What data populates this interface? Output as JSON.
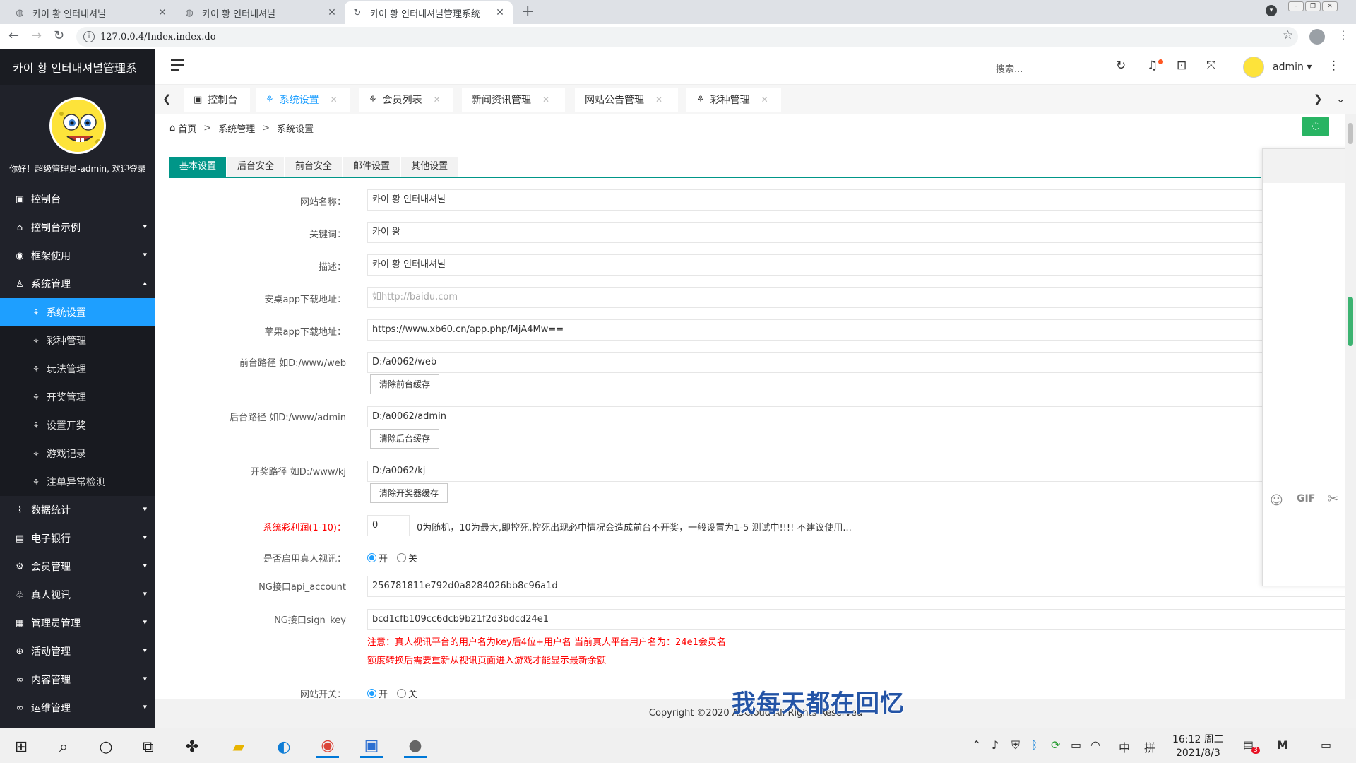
{
  "browser": {
    "tabs": [
      {
        "title": "카이 황 인터내셔널",
        "active": false
      },
      {
        "title": "카이 황 인터내셔널",
        "active": false
      },
      {
        "title": "카이 황 인터내셔널管理系统",
        "active": true
      }
    ],
    "new_tab": "+",
    "url": "127.0.0.4/Index.index.do"
  },
  "sidebar": {
    "logo": "카이 황 인터내셔널管理系",
    "welcome": "你好！超级管理员-admin, 欢迎登录",
    "menu": [
      {
        "label": "控制台",
        "icon": "dashboard-icon",
        "glyph": "▣",
        "has_arrow": false
      },
      {
        "label": "控制台示例",
        "icon": "home-icon",
        "glyph": "⌂",
        "has_arrow": true
      },
      {
        "label": "框架使用",
        "icon": "layers-icon",
        "glyph": "◉",
        "has_arrow": true
      },
      {
        "label": "系统管理",
        "icon": "user-icon",
        "glyph": "♙",
        "has_arrow": true,
        "expanded": true
      }
    ],
    "submenu": [
      {
        "label": "系统设置",
        "active": true
      },
      {
        "label": "彩种管理",
        "active": false
      },
      {
        "label": "玩法管理",
        "active": false
      },
      {
        "label": "开奖管理",
        "active": false
      },
      {
        "label": "设置开奖",
        "active": false
      },
      {
        "label": "游戏记录",
        "active": false
      },
      {
        "label": "注单异常检测",
        "active": false
      }
    ],
    "menu_after": [
      {
        "label": "数据统计",
        "icon": "chart-icon",
        "glyph": "⌇"
      },
      {
        "label": "电子银行",
        "icon": "bank-icon",
        "glyph": "▤"
      },
      {
        "label": "会员管理",
        "icon": "settings-icon",
        "glyph": "⚙"
      },
      {
        "label": "真人视讯",
        "icon": "video-icon",
        "glyph": "♧"
      },
      {
        "label": "管理员管理",
        "icon": "grid-icon",
        "glyph": "▦"
      },
      {
        "label": "活动管理",
        "icon": "plus-circle-icon",
        "glyph": "⊕"
      },
      {
        "label": "内容管理",
        "icon": "link-icon",
        "glyph": "∞"
      },
      {
        "label": "运维管理",
        "icon": "link-icon",
        "glyph": "∞"
      }
    ]
  },
  "header": {
    "search_placeholder": "搜索...",
    "user": "admin"
  },
  "page_tabs": [
    {
      "label": "控制台",
      "glyph": "▣",
      "active": false,
      "closable": false
    },
    {
      "label": "系统设置",
      "glyph": "⚘",
      "active": true,
      "closable": true
    },
    {
      "label": "会员列表",
      "glyph": "⚘",
      "active": false,
      "closable": true
    },
    {
      "label": "新闻资讯管理",
      "glyph": "",
      "active": false,
      "closable": true
    },
    {
      "label": "网站公告管理",
      "glyph": "",
      "active": false,
      "closable": true
    },
    {
      "label": "彩种管理",
      "glyph": "⚘",
      "active": false,
      "closable": true
    }
  ],
  "breadcrumb": [
    "首页",
    "系统管理",
    "系统设置"
  ],
  "settings_tabs": [
    "基本设置",
    "后台安全",
    "前台安全",
    "邮件设置",
    "其他设置"
  ],
  "form": {
    "site_name_label": "网站名称：",
    "site_name": "카이 황 인터내셔널",
    "keywords_label": "关键词：",
    "keywords": "카이 왕",
    "desc_label": "描述：",
    "desc": "카이 황 인터내셔널",
    "android_label": "安桌app下载地址：",
    "android_placeholder": "如http://baidu.com",
    "ios_label": "苹果app下载地址：",
    "ios": "https://www.xb60.cn/app.php/MjA4Mw==",
    "front_path_label": "前台路径 如D:/www/web",
    "front_path": "D:/a0062/web",
    "clear_front": "清除前台缓存",
    "back_path_label": "后台路径 如D:/www/admin",
    "back_path": "D:/a0062/admin",
    "clear_back": "清除后台缓存",
    "kj_path_label": "开奖路径 如D:/www/kj",
    "kj_path": "D:/a0062/kj",
    "clear_kj": "清除开奖器缓存",
    "profit_label": "系统彩利润(1-10)：",
    "profit": "0",
    "profit_hint": "0为随机，10为最大,即控死,控死出现必中情况会造成前台不开奖，一般设置为1-5 测试中!!!! 不建议使用...",
    "live_label": "是否启用真人视讯：",
    "on": "开",
    "off": "关",
    "ng_account_label": "NG接口api_account",
    "ng_account": "256781811e792d0a8284026bb8c96a1d",
    "ng_key_label": "NG接口sign_key",
    "ng_key": "bcd1cfb109cc6dcb9b21f2d3bdcd24e1",
    "note1": "注意：真人视讯平台的用户名为key后4位+用户名 当前真人平台用户名为：24e1会员名",
    "note2": "额度转换后需要重新从视讯页面进入游戏才能显示最新余额",
    "site_switch_label": "网站开关："
  },
  "footer": {
    "copyright": "Copyright ©2020 A3Cloud All Rights Reserved",
    "overlay": "我每天都在回忆"
  },
  "taskbar": {
    "time": "16:12 周二",
    "date": "2021/8/3",
    "ime_lang": "中",
    "ime_mode": "拼",
    "badge": "3"
  }
}
